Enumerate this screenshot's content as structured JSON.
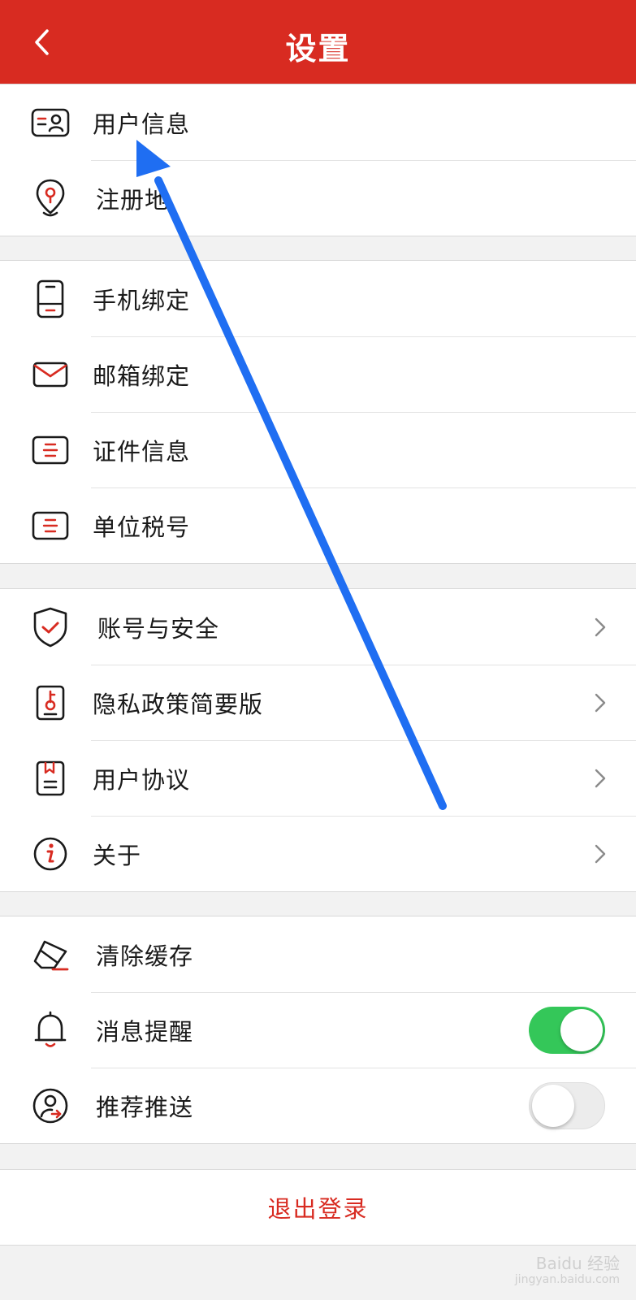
{
  "header": {
    "title": "设置"
  },
  "groups": [
    {
      "items": [
        {
          "label": "用户信息",
          "icon": "id-card-icon"
        },
        {
          "label": "注册地",
          "icon": "location-pin-icon"
        }
      ]
    },
    {
      "items": [
        {
          "label": "手机绑定",
          "icon": "phone-icon"
        },
        {
          "label": "邮箱绑定",
          "icon": "envelope-icon"
        },
        {
          "label": "证件信息",
          "icon": "certificate-icon"
        },
        {
          "label": "单位税号",
          "icon": "tax-document-icon"
        }
      ]
    },
    {
      "items": [
        {
          "label": "账号与安全",
          "icon": "shield-check-icon"
        },
        {
          "label": "隐私政策简要版",
          "icon": "privacy-key-icon"
        },
        {
          "label": "用户协议",
          "icon": "agreement-doc-icon"
        },
        {
          "label": "关于",
          "icon": "info-icon"
        }
      ]
    },
    {
      "items": [
        {
          "label": "清除缓存",
          "icon": "eraser-icon"
        },
        {
          "label": "消息提醒",
          "icon": "bell-icon",
          "toggle": true
        },
        {
          "label": "推荐推送",
          "icon": "user-push-icon",
          "toggle": false
        }
      ]
    }
  ],
  "logout_label": "退出登录",
  "watermark": {
    "line1": "Baidu 经验",
    "line2": "jingyan.baidu.com"
  },
  "colors": {
    "brand": "#d82b21",
    "toggle_on": "#34c759",
    "annotation_arrow": "#1f6ef2"
  }
}
